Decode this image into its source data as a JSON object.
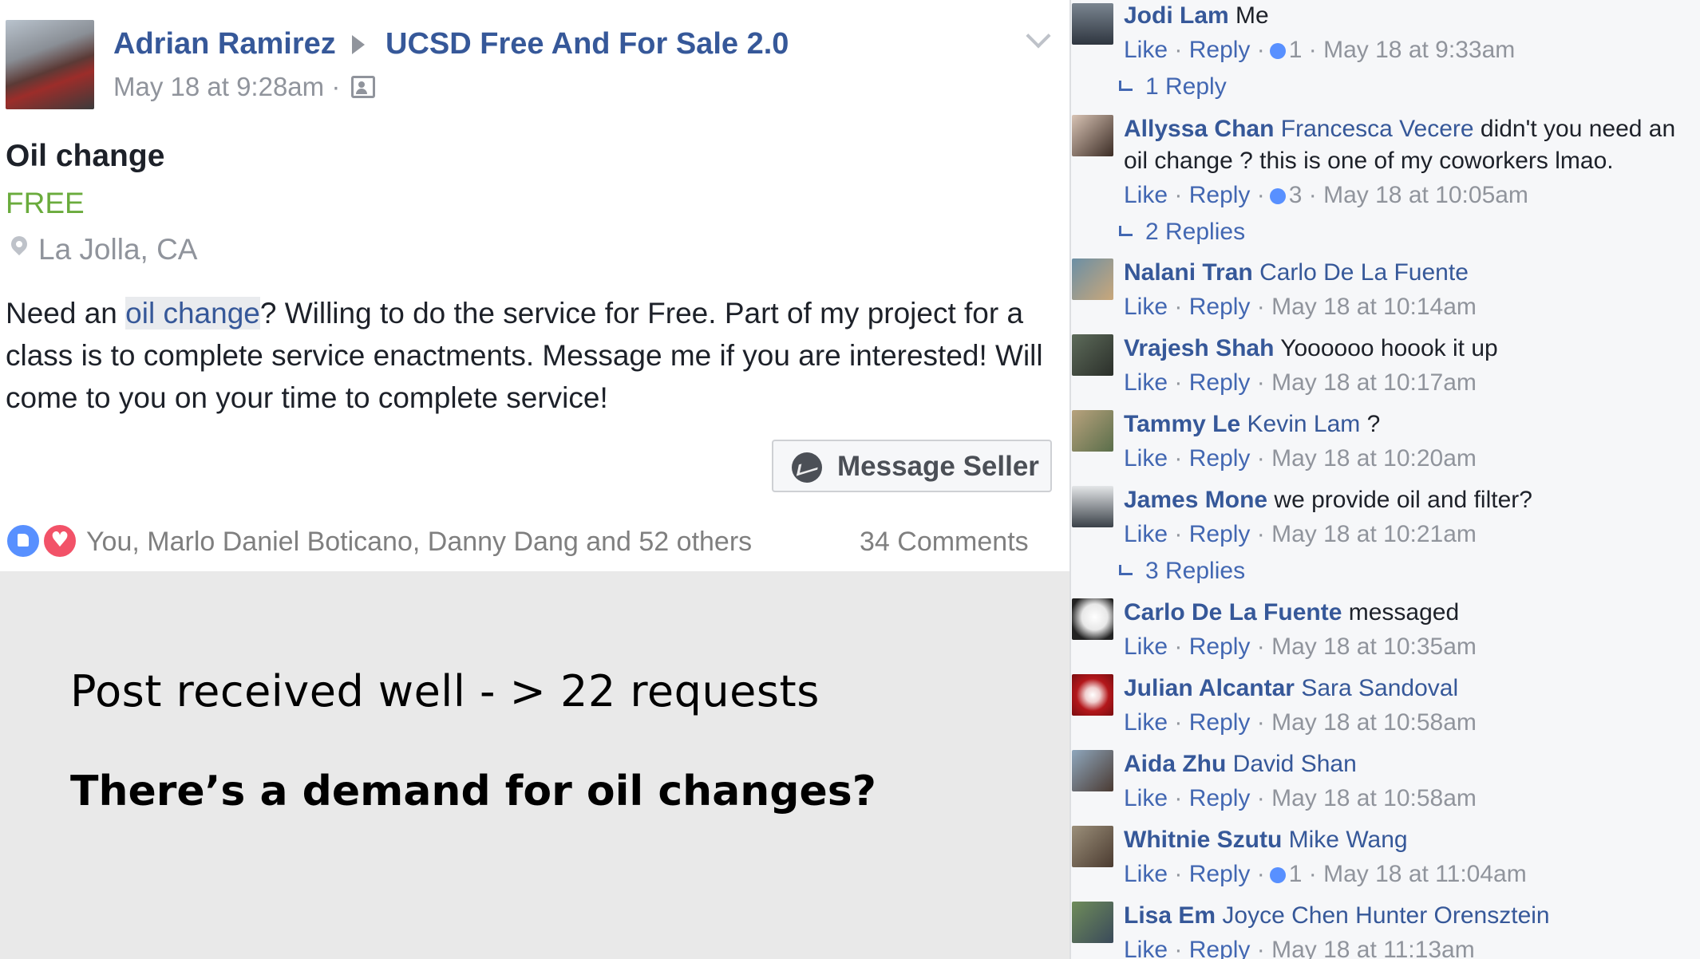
{
  "post": {
    "author": "Adrian Ramirez",
    "group": "UCSD Free And For Sale 2.0",
    "time": "May 18 at 9:28am ·",
    "title": "Oil change",
    "price": "FREE",
    "location": "La Jolla, CA",
    "body_before": "Need an ",
    "body_highlight": "oil change",
    "body_after": "? Willing to do the service for Free. Part of my project for a class is to complete service enactments. Message me if you are interested! Will come to you on your time to complete service!",
    "message_button": "Message Seller",
    "reactions_text": "You, Marlo Daniel Boticano, Danny Dang and 52 others",
    "comments_count": "34 Comments",
    "icons": {
      "audience": "friends-audience-icon",
      "location": "location-pin-icon",
      "menu": "chevron-down-icon",
      "messenger": "messenger-icon",
      "like": "like-reaction-icon",
      "love": "love-reaction-icon"
    }
  },
  "slide": {
    "line1": "Post received well - > 22 requests",
    "line2": "There’s a demand for oil changes?"
  },
  "comments": [
    {
      "name": "Jodi Lam",
      "tag": "",
      "text": " Me",
      "text2": "",
      "like": "Like",
      "reply": "Reply",
      "reaction_count": "1",
      "time": "May 18 at 9:33am",
      "replies": "1 Reply"
    },
    {
      "name": "Allyssa Chan",
      "tag": "Francesca Vecere",
      "text": " didn't you need an",
      "text2": "oil change ? this is one of my coworkers lmao.",
      "like": "Like",
      "reply": "Reply",
      "reaction_count": "3",
      "time": "May 18 at 10:05am",
      "replies": "2 Replies"
    },
    {
      "name": "Nalani Tran",
      "tag": "Carlo De La Fuente",
      "text": "",
      "text2": "",
      "like": "Like",
      "reply": "Reply",
      "reaction_count": "",
      "time": "May 18 at 10:14am",
      "replies": ""
    },
    {
      "name": "Vrajesh Shah",
      "tag": "",
      "text": " Yoooooo hoook it up",
      "text2": "",
      "like": "Like",
      "reply": "Reply",
      "reaction_count": "",
      "time": "May 18 at 10:17am",
      "replies": ""
    },
    {
      "name": "Tammy Le",
      "tag": "Kevin Lam",
      "text": " ?",
      "text2": "",
      "like": "Like",
      "reply": "Reply",
      "reaction_count": "",
      "time": "May 18 at 10:20am",
      "replies": ""
    },
    {
      "name": "James Mone",
      "tag": "",
      "text": " we provide oil and filter?",
      "text2": "",
      "like": "Like",
      "reply": "Reply",
      "reaction_count": "",
      "time": "May 18 at 10:21am",
      "replies": "3 Replies"
    },
    {
      "name": "Carlo De La Fuente",
      "tag": "",
      "text": " messaged",
      "text2": "",
      "like": "Like",
      "reply": "Reply",
      "reaction_count": "",
      "time": "May 18 at 10:35am",
      "replies": ""
    },
    {
      "name": "Julian Alcantar",
      "tag": "Sara Sandoval",
      "text": "",
      "text2": "",
      "like": "Like",
      "reply": "Reply",
      "reaction_count": "",
      "time": "May 18 at 10:58am",
      "replies": ""
    },
    {
      "name": "Aida Zhu",
      "tag": "David Shan",
      "text": "",
      "text2": "",
      "like": "Like",
      "reply": "Reply",
      "reaction_count": "",
      "time": "May 18 at 10:58am",
      "replies": ""
    },
    {
      "name": "Whitnie Szutu",
      "tag": "Mike Wang",
      "text": "",
      "text2": "",
      "like": "Like",
      "reply": "Reply",
      "reaction_count": "1",
      "time": "May 18 at 11:04am",
      "replies": ""
    },
    {
      "name": "Lisa Em",
      "tag": "Joyce Chen Hunter Orensztein",
      "text": "",
      "text2": "",
      "like": "Like",
      "reply": "Reply",
      "reaction_count": "",
      "time": "May 18 at 11:13am",
      "replies": ""
    }
  ],
  "colors": {
    "link": "#365899",
    "price": "#6aab3c",
    "meta": "#90949c",
    "like": "#5890ff",
    "love": "#f25268"
  }
}
